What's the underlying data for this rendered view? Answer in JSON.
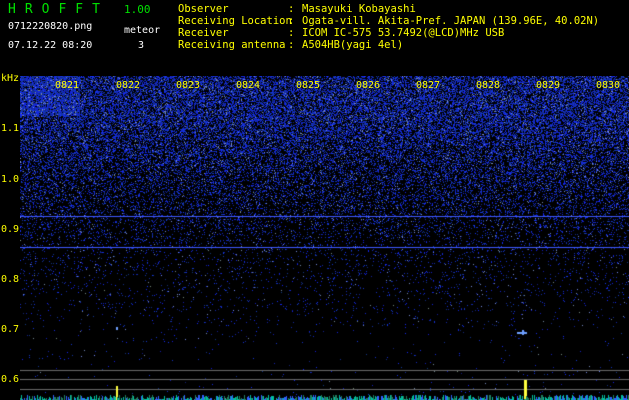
{
  "header": {
    "title": "HROFFT",
    "version": "1.00",
    "filename": "0712220820.png",
    "datetime": "07.12.22 08:20",
    "meteor_label": "meteor",
    "meteor_count": "3"
  },
  "info": [
    {
      "label": "Observer",
      "value": "Masayuki Kobayashi"
    },
    {
      "label": "Receiving Location",
      "value": "Ogata-vill. Akita-Pref. JAPAN (139.96E, 40.02N)"
    },
    {
      "label": "Receiver",
      "value": "ICOM IC-575 53.7492(@LCD)MHz USB"
    },
    {
      "label": "Receiving antenna",
      "value": "A504HB(yagi 4el)"
    }
  ],
  "axis": {
    "unit": "kHz",
    "y_ticks": [
      "1.1",
      "1.0",
      "0.9",
      "0.8",
      "0.7",
      "0.6"
    ],
    "x_ticks": [
      "0821",
      "0822",
      "0823",
      "0824",
      "0825",
      "0826",
      "0827",
      "0828",
      "0829",
      "0830"
    ]
  },
  "colors": {
    "label": "#ffff00",
    "title": "#00e000",
    "noise": "#2a3cff",
    "line": "#7fa0ff"
  }
}
